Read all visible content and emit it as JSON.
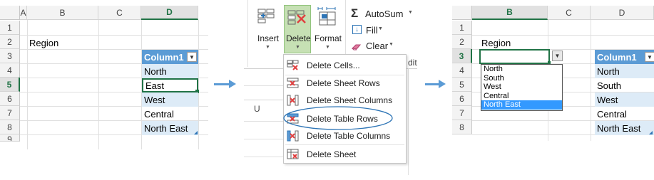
{
  "left_sheet": {
    "columns": [
      "A",
      "B",
      "C",
      "D"
    ],
    "rows": [
      "1",
      "2",
      "3",
      "4",
      "5",
      "6",
      "7",
      "8",
      "9"
    ],
    "region_label": "Region",
    "table_header": "Column1",
    "table_values": [
      "North",
      "East",
      "West",
      "Central",
      "North East"
    ]
  },
  "ribbon": {
    "insert_label": "Insert",
    "delete_label": "Delete",
    "format_label": "Format",
    "autosum_label": "AutoSum",
    "fill_label": "Fill",
    "clear_label": "Clear",
    "cut_off_text": "dit",
    "column_fragment": "U"
  },
  "delete_menu": {
    "items": [
      "Delete Cells...",
      "Delete Sheet Rows",
      "Delete Sheet Columns",
      "Delete Table Rows",
      "Delete Table Columns",
      "Delete Sheet"
    ]
  },
  "right_sheet": {
    "columns": [
      "B",
      "C",
      "D"
    ],
    "rows": [
      "1",
      "2",
      "3",
      "4",
      "5",
      "6",
      "7",
      "8"
    ],
    "region_label": "Region",
    "dropdown_options": [
      "North",
      "South",
      "West",
      "Central",
      "North East"
    ],
    "dropdown_selected": "North East",
    "table_header": "Column1",
    "table_values": [
      "North",
      "South",
      "West",
      "Central",
      "North East"
    ]
  },
  "colors": {
    "table_header": "#5b9bd5",
    "table_band": "#ddebf7",
    "excel_green": "#217346",
    "delete_highlight": "#c6e0b4",
    "arrow": "#5b9bd5",
    "dropdown_selected": "#3399ff"
  }
}
